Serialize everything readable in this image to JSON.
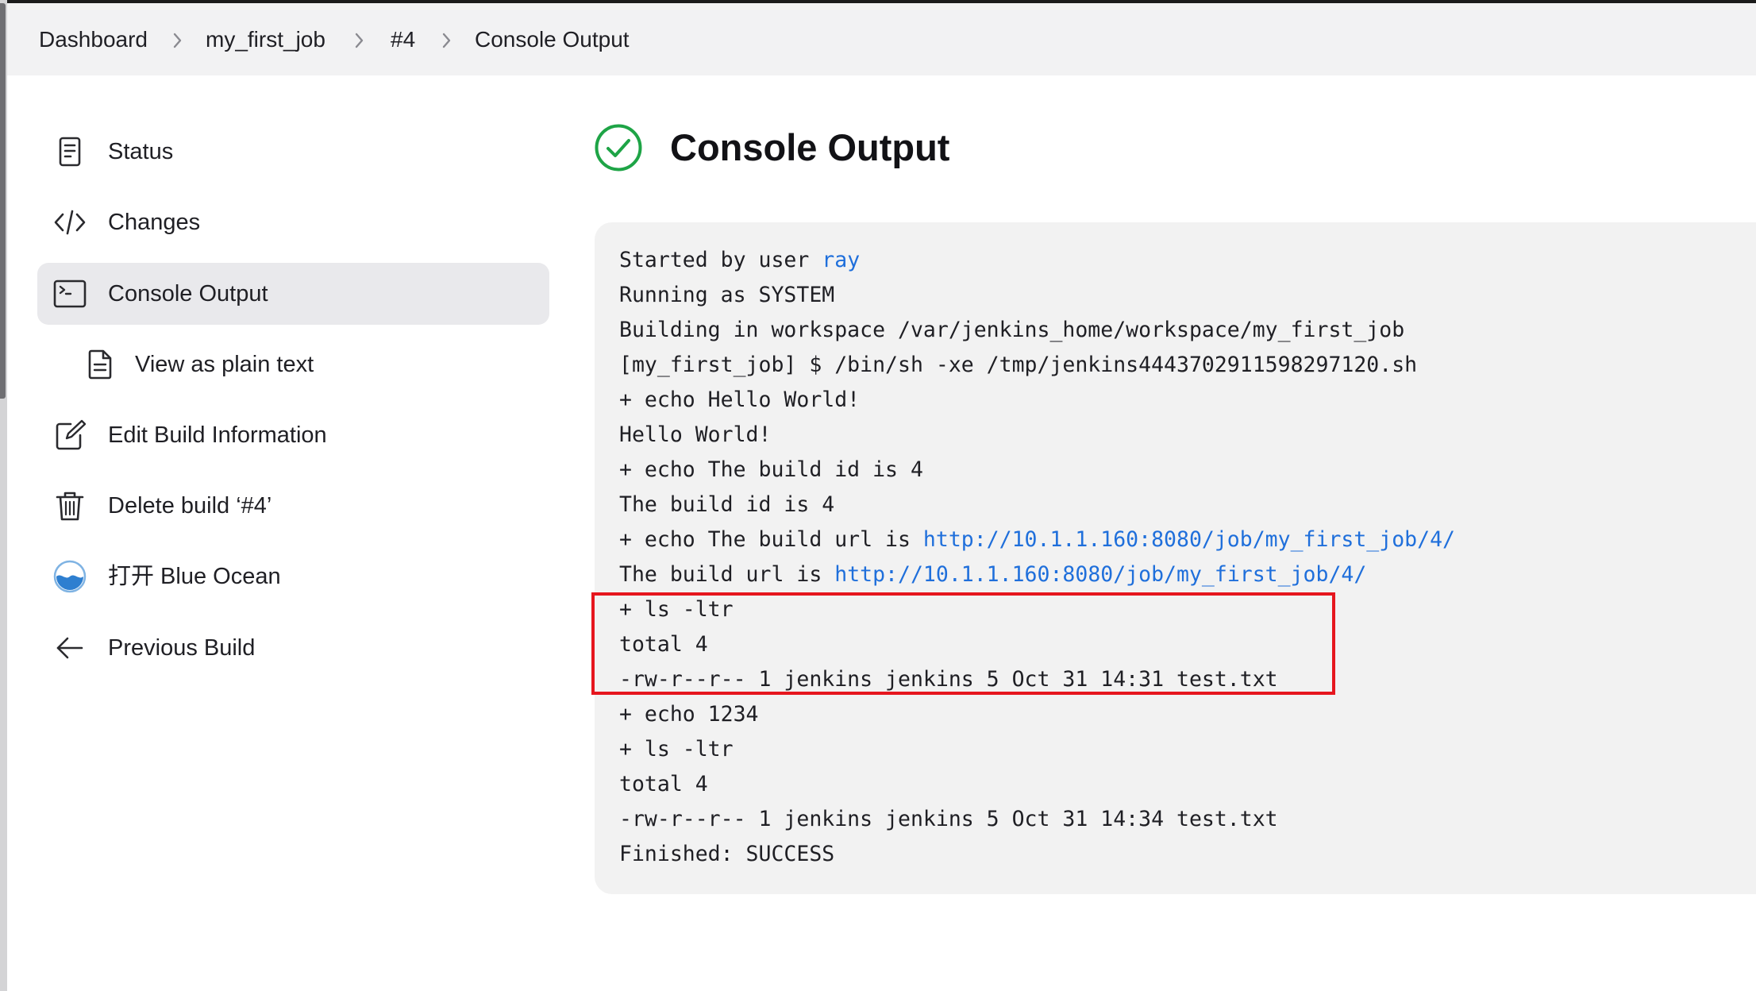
{
  "breadcrumb": {
    "items": [
      "Dashboard",
      "my_first_job",
      "#4",
      "Console Output"
    ]
  },
  "sidebar": {
    "items": [
      {
        "label": "Status",
        "icon": "document-icon"
      },
      {
        "label": "Changes",
        "icon": "code-icon"
      },
      {
        "label": "Console Output",
        "icon": "terminal-icon",
        "active": true
      },
      {
        "label": "View as plain text",
        "icon": "file-text-icon"
      },
      {
        "label": "Edit Build Information",
        "icon": "edit-icon"
      },
      {
        "label": "Delete build ‘#4’",
        "icon": "trash-icon"
      },
      {
        "label": "打开 Blue Ocean",
        "icon": "blue-ocean-icon"
      },
      {
        "label": "Previous Build",
        "icon": "arrow-left-icon"
      }
    ]
  },
  "main": {
    "title": "Console Output",
    "status_icon": "success-check-icon",
    "status_color": "#1ea446",
    "link_color": "#1f6fdb",
    "highlight_color": "#e6161e"
  },
  "console": {
    "lines": [
      {
        "text": "Started by user ",
        "link": "ray"
      },
      {
        "text": "Running as SYSTEM"
      },
      {
        "text": "Building in workspace /var/jenkins_home/workspace/my_first_job"
      },
      {
        "text": "[my_first_job] $ /bin/sh -xe /tmp/jenkins4443702911598297120.sh"
      },
      {
        "text": "+ echo Hello World!"
      },
      {
        "text": "Hello World!"
      },
      {
        "text": "+ echo The build id is 4"
      },
      {
        "text": "The build id is 4"
      },
      {
        "text": "+ echo The build url is ",
        "link": "http://10.1.1.160:8080/job/my_first_job/4/"
      },
      {
        "text": "The build url is ",
        "link": "http://10.1.1.160:8080/job/my_first_job/4/"
      },
      {
        "text": "+ ls -ltr"
      },
      {
        "text": "total 4"
      },
      {
        "text": "-rw-r--r-- 1 jenkins jenkins 5 Oct 31 14:31 test.txt"
      },
      {
        "text": "+ echo 1234"
      },
      {
        "text": "+ ls -ltr"
      },
      {
        "text": "total 4"
      },
      {
        "text": "-rw-r--r-- 1 jenkins jenkins 5 Oct 31 14:34 test.txt"
      },
      {
        "text": "Finished: SUCCESS"
      }
    ]
  }
}
